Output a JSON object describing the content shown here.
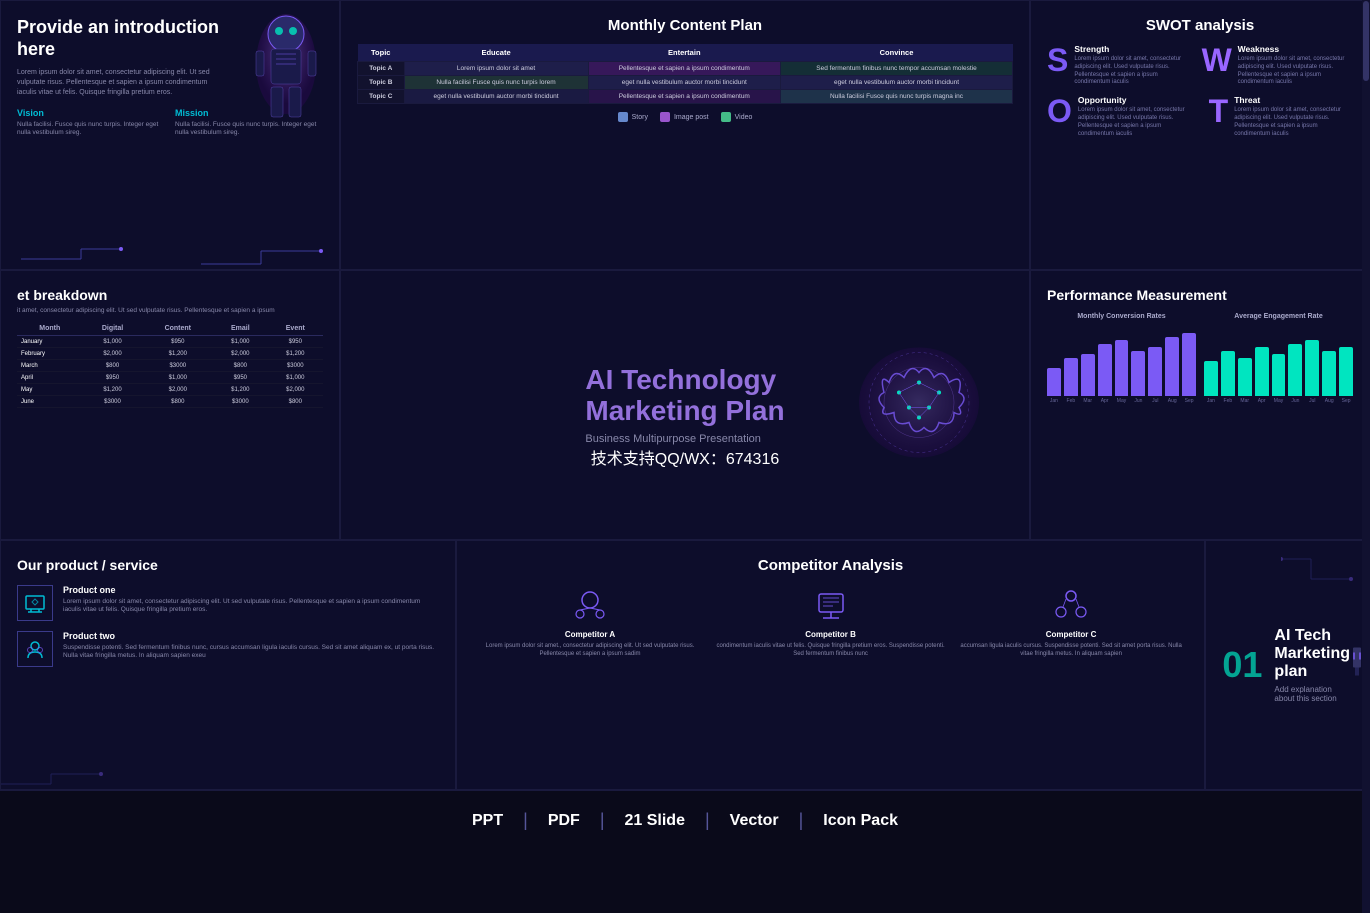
{
  "slides": {
    "intro": {
      "title": "Provide an introduction here",
      "body": "Lorem ipsum dolor sit amet, consectetur adipiscing elit. Ut sed vulputate risus. Pellentesque et sapien a ipsum condimentum iaculis vitae ut felis. Quisque fringilla pretium eros.",
      "vision_label": "Vision",
      "vision_text": "Nulla facilisi. Fusce quis nunc turpis. Integer eget nulla vestibulum sireg.",
      "mission_label": "Mission",
      "mission_text": "Nulla facilisi. Fusce quis nunc turpis. Integer eget nulla vestibulum sireg."
    },
    "monthly": {
      "title": "Monthly Content Plan",
      "headers": [
        "Topic",
        "Educate",
        "Entertain",
        "Convince"
      ],
      "rows": [
        {
          "topic": "Topic A",
          "educate": "Lorem ipsum dolor sit amet",
          "entertain": "Pellentesque et sapien a ipsum condimentum",
          "convince": "Sed fermentum finibus nunc tempor accumsan molestie"
        },
        {
          "topic": "Topic B",
          "educate": "Nulla facilisi Fusce quis nunc turpis lorem",
          "entertain": "eget nulla vestibulum auctor morbi tincidunt",
          "convince": "eget nulla vestibulum auctor morbi tincidunt"
        },
        {
          "topic": "Topic C",
          "educate": "eget nulla vestibulum auctor morbi tincidunt",
          "entertain": "Pellentesque et sapien a ipsum condimentum",
          "convince": "Nulla facilisi Fusce quis nunc turpis magna inc"
        }
      ],
      "legend": [
        {
          "label": "Story",
          "color": "#6688cc"
        },
        {
          "label": "Image post",
          "color": "#9955cc"
        },
        {
          "label": "Video",
          "color": "#44bb88"
        }
      ]
    },
    "swot": {
      "title": "SWOT analysis",
      "strength_label": "Strength",
      "strength_letter": "S",
      "strength_text": "Lorem ipsum dolor sit amet, consectetur adipiscing elit. Used vulputate risus. Pellentesque et sapien a ipsum condimentum iaculis",
      "weakness_label": "Weakness",
      "weakness_letter": "W",
      "weakness_text": "Lorem ipsum dolor sit amet, consectetur adipiscing elit. Used vulputate risus. Pellentesque et sapien a ipsum condimentum iaculis",
      "opportunity_label": "Opportunity",
      "opportunity_letter": "O",
      "opportunity_text": "Lorem ipsum dolor sit amet, consectetur adipiscing elit. Used vulputate risus. Pellentesque et sapien a ipsum condimentum iaculis",
      "threat_label": "Threat",
      "threat_letter": "T",
      "threat_text": "Lorem ipsum dolor sit amet, consectetur adipiscing elit. Used vulputate risus. Pellentesque et sapien a ipsum condimentum iaculis"
    },
    "budget": {
      "title": "et breakdown",
      "sub": "it amet, consectetur adipiscing elit. Ut sed vulputate risus. Pellentesque et sapien a ipsum",
      "headers": [
        "Month",
        "Digital",
        "Content",
        "Email",
        "Event"
      ],
      "rows": [
        [
          "January",
          "$1,000",
          "$950",
          "$1,000",
          "$950"
        ],
        [
          "February",
          "$2,000",
          "$1,200",
          "$2,000",
          "$1,200"
        ],
        [
          "March",
          "$800",
          "$3000",
          "$800",
          "$3000"
        ],
        [
          "April",
          "$950",
          "$1,000",
          "$950",
          "$1,000"
        ],
        [
          "May",
          "$1,200",
          "$2,000",
          "$1,200",
          "$2,000"
        ],
        [
          "June",
          "$3000",
          "$800",
          "$3000",
          "$800"
        ]
      ]
    },
    "hero": {
      "title_line1": "AI Technology",
      "title_line2": "Marketing Plan",
      "subtitle": "Business Multipurpose Presentation"
    },
    "performance": {
      "title": "Performance Measurement",
      "chart1_title": "Monthly Conversion Rates",
      "chart2_title": "Average Engagement Rate",
      "chart1_bars": [
        40,
        55,
        60,
        75,
        80,
        65,
        70,
        85,
        90
      ],
      "chart2_bars": [
        50,
        65,
        55,
        70,
        60,
        75,
        80,
        65,
        70
      ],
      "chart1_labels": [
        "Jan",
        "Feb",
        "Mar",
        "Apr",
        "May",
        "Jun",
        "Jul",
        "Aug",
        "Sep"
      ],
      "chart2_labels": [
        "Jan",
        "Feb",
        "Mar",
        "Apr",
        "May",
        "Jun",
        "Jul",
        "Aug",
        "Sep"
      ]
    },
    "product": {
      "title": "Our product / service",
      "product1_name": "Product one",
      "product1_text": "Lorem ipsum dolor sit amet, consectetur adipiscing elit. Ut sed vulputate risus. Pellentesque et sapien a ipsum condimentum iaculis vitae ut felis. Quisque fringilla pretium eros.",
      "product2_name": "Product two",
      "product2_text": "Suspendisse potenti. Sed fermentum finibus nunc, cursus accumsan ligula iaculis cursus. Sed sit amet aliquam ex, ut porta risus. Nulla vitae fringilla metus. In aliquam sapien exeu"
    },
    "competitor": {
      "title": "Competitor Analysis",
      "comp_a_name": "Competitor A",
      "comp_a_text": "Lorem ipsum dolor sit amet., consectetur adipiscing elit. Ut sed vulputate risus. Pellentesque et sapien a ipsum sadim",
      "comp_b_name": "Competitor B",
      "comp_b_text": "condimentum iaculis vitae ut felis. Quisque fringilla pretium eros. Suspendisse potenti. Sed fermentum finibus nunc",
      "comp_c_name": "Competitor C",
      "comp_c_text": "accumsan ligula iaculis cursus. Suspendisse potenti. Sed sit amet porta risus. Nulla vitae fringilla metus. In aliquam sapien"
    },
    "aitech": {
      "number": "01",
      "title_line1": "AI Tech",
      "title_line2": "Marketing plan",
      "subtitle": "Add explanation about this section"
    }
  },
  "watermark": "技术支持QQ/WX：674316",
  "footer": {
    "items": [
      "PPT",
      "PDF",
      "21 Slide",
      "Vector",
      "Icon Pack"
    ],
    "separators": [
      "|",
      "|",
      "|",
      "|"
    ]
  }
}
